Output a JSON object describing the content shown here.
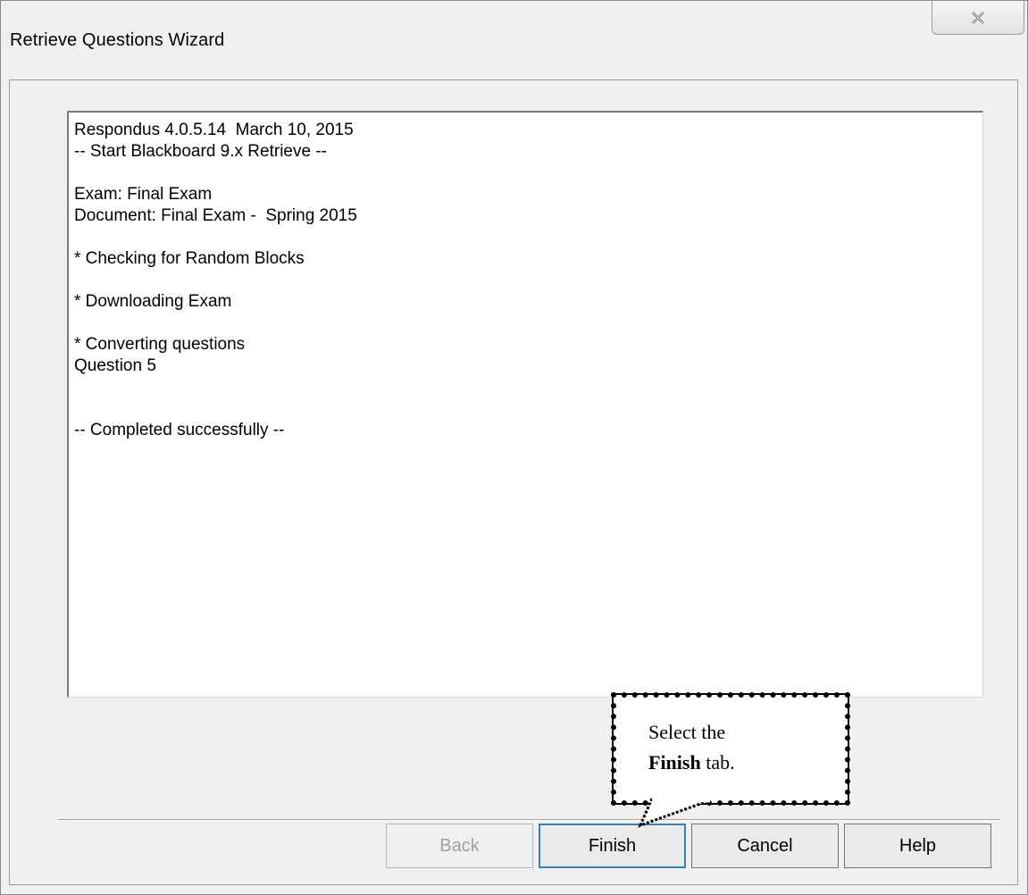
{
  "window": {
    "title": "Retrieve Questions Wizard",
    "close_icon": "close-icon"
  },
  "log": {
    "lines": [
      "Respondus 4.0.5.14  March 10, 2015",
      "-- Start Blackboard 9.x Retrieve --",
      "",
      "Exam: Final Exam",
      "Document: Final Exam -  Spring 2015",
      "",
      "* Checking for Random Blocks",
      "",
      "* Downloading Exam",
      "",
      "* Converting questions",
      "Question 5",
      "",
      "",
      "-- Completed successfully --"
    ]
  },
  "buttons": {
    "back": "Back",
    "finish": "Finish",
    "cancel": "Cancel",
    "help": "Help"
  },
  "callout": {
    "line1": "Select the",
    "bold": "Finish",
    "rest": " tab."
  }
}
